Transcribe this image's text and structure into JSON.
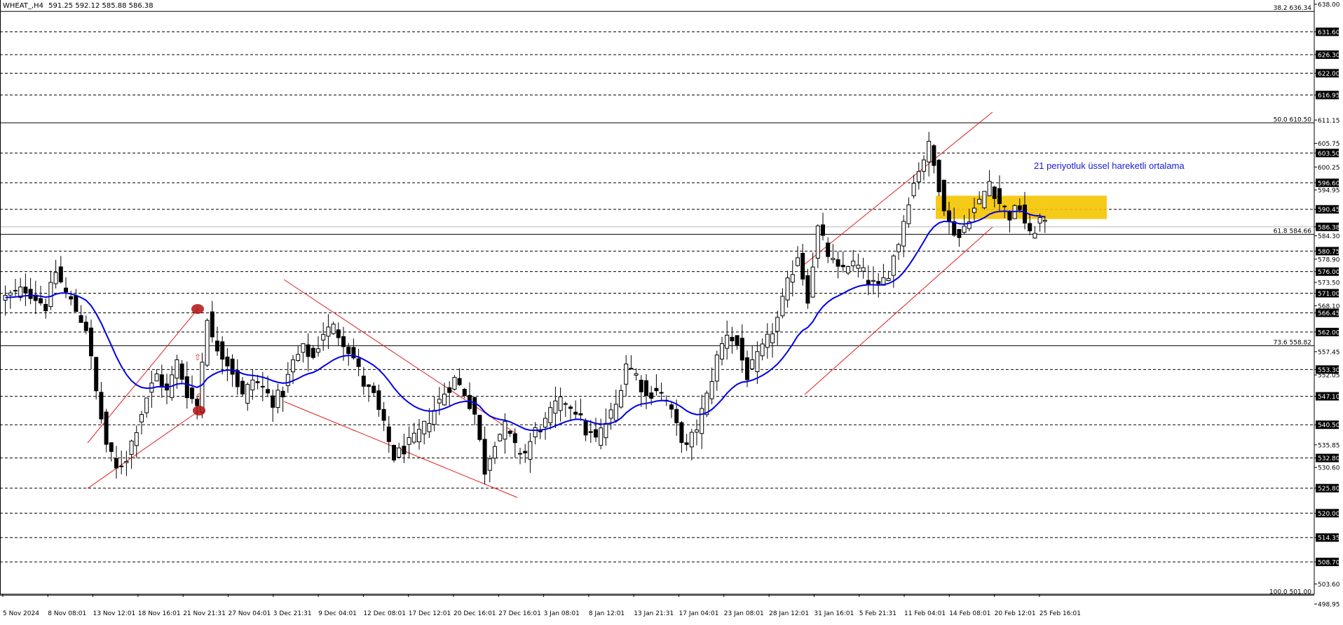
{
  "header": {
    "symbol": "WHEAT_,H4",
    "ohlc": "591.25 592.12 585.88 586.38"
  },
  "annotation": {
    "text": "21 periyotluk üssel hareketli ortalama"
  },
  "colors": {
    "background": "#ffffff",
    "candle": "#000000",
    "ema": "#0000e6",
    "channel": "#e02020",
    "zone": "#f5c400",
    "grid": "#000000",
    "marker": "#b01010",
    "arrow": "#e02020"
  },
  "chart_data": {
    "type": "candlestick",
    "ylim": [
      498.95,
      638.0
    ],
    "grid": true,
    "price_axis_labels": [
      "638.00",
      "631.60",
      "626.30",
      "622.00",
      "616.95",
      "611.15",
      "605.75",
      "603.50",
      "600.25",
      "596.60",
      "594.95",
      "590.45",
      "586.38",
      "584.30",
      "580.75",
      "578.90",
      "576.00",
      "573.50",
      "571.00",
      "568.10",
      "566.45",
      "562.00",
      "557.45",
      "553.30",
      "552.05",
      "547.10",
      "540.50",
      "535.85",
      "532.80",
      "530.60",
      "525.80",
      "520.00",
      "514.35",
      "508.70",
      "503.60",
      "498.95"
    ],
    "highlighted_levels": [
      631.6,
      626.3,
      622.0,
      616.95,
      603.5,
      596.6,
      590.45,
      586.38,
      580.75,
      576.0,
      571.0,
      566.45,
      562.0,
      553.3,
      547.1,
      540.5,
      532.8,
      525.8,
      520.0,
      514.35,
      508.7
    ],
    "dashed_levels": [
      631.6,
      626.3,
      622.0,
      616.95,
      603.5,
      596.6,
      590.45,
      580.75,
      576.0,
      571.0,
      566.45,
      562.0,
      553.3,
      547.1,
      540.5,
      532.8,
      525.8,
      520.0,
      514.35,
      508.7
    ],
    "current_price": 586.38,
    "fibonacci": [
      {
        "label": "38.2 636.34",
        "price": 636.34
      },
      {
        "label": "50.0 610.50",
        "price": 610.5
      },
      {
        "label": "61.8 584.66",
        "price": 584.66
      },
      {
        "label": "73.6 558.82",
        "price": 558.82
      },
      {
        "label": "100.0 501.00",
        "price": 501.0
      }
    ],
    "time_labels": [
      "5 Nov 2024",
      "8 Nov 08:01",
      "13 Nov 12:01",
      "18 Nov 16:01",
      "21 Nov 21:31",
      "27 Nov 04:01",
      "3 Dec 21:31",
      "9 Dec 04:01",
      "12 Dec 08:01",
      "17 Dec 12:01",
      "20 Dec 16:01",
      "27 Dec 16:01",
      "3 Jan 08:01",
      "8 Jan 12:01",
      "13 Jan 21:31",
      "17 Jan 04:01",
      "23 Jan 08:01",
      "28 Jan 12:01",
      "31 Jan 16:01",
      "5 Feb 21:31",
      "11 Feb 04:01",
      "14 Feb 08:01",
      "20 Feb 12:01",
      "25 Feb 16:01"
    ],
    "close_path": [
      [
        0,
        570
      ],
      [
        4,
        572
      ],
      [
        8,
        568
      ],
      [
        10,
        576
      ],
      [
        12,
        571
      ],
      [
        16,
        563
      ],
      [
        18,
        548
      ],
      [
        20,
        536
      ],
      [
        22,
        530
      ],
      [
        24,
        533
      ],
      [
        26,
        540
      ],
      [
        28,
        547
      ],
      [
        30,
        552
      ],
      [
        32,
        548
      ],
      [
        34,
        555
      ],
      [
        36,
        548
      ],
      [
        38,
        545
      ],
      [
        40,
        566
      ],
      [
        41,
        560
      ],
      [
        43,
        557
      ],
      [
        45,
        553
      ],
      [
        47,
        547
      ],
      [
        49,
        551
      ],
      [
        51,
        549
      ],
      [
        53,
        546
      ],
      [
        55,
        548
      ],
      [
        57,
        555
      ],
      [
        59,
        558
      ],
      [
        61,
        556
      ],
      [
        63,
        562
      ],
      [
        65,
        563
      ],
      [
        67,
        560
      ],
      [
        69,
        556
      ],
      [
        71,
        550
      ],
      [
        73,
        547
      ],
      [
        75,
        540
      ],
      [
        77,
        533
      ],
      [
        79,
        535
      ],
      [
        81,
        537
      ],
      [
        83,
        540
      ],
      [
        85,
        544
      ],
      [
        87,
        548
      ],
      [
        89,
        551
      ],
      [
        91,
        548
      ],
      [
        93,
        543
      ],
      [
        95,
        530
      ],
      [
        97,
        537
      ],
      [
        99,
        540
      ],
      [
        101,
        535
      ],
      [
        103,
        534
      ],
      [
        105,
        539
      ],
      [
        107,
        541
      ],
      [
        109,
        545
      ],
      [
        111,
        546
      ],
      [
        113,
        544
      ],
      [
        115,
        539
      ],
      [
        117,
        537
      ],
      [
        119,
        541
      ],
      [
        121,
        545
      ],
      [
        123,
        555
      ],
      [
        125,
        552
      ],
      [
        127,
        547
      ],
      [
        129,
        549
      ],
      [
        131,
        546
      ],
      [
        133,
        540
      ],
      [
        135,
        535
      ],
      [
        137,
        540
      ],
      [
        139,
        547
      ],
      [
        141,
        556
      ],
      [
        143,
        562
      ],
      [
        145,
        559
      ],
      [
        147,
        552
      ],
      [
        149,
        556
      ],
      [
        151,
        560
      ],
      [
        153,
        565
      ],
      [
        155,
        573
      ],
      [
        157,
        580
      ],
      [
        159,
        570
      ],
      [
        161,
        586
      ],
      [
        163,
        580
      ],
      [
        165,
        576
      ],
      [
        167,
        578
      ],
      [
        169,
        577
      ],
      [
        171,
        574
      ],
      [
        173,
        572
      ],
      [
        175,
        576
      ],
      [
        177,
        583
      ],
      [
        179,
        593
      ],
      [
        181,
        600
      ],
      [
        183,
        605
      ],
      [
        185,
        596
      ],
      [
        187,
        587
      ],
      [
        189,
        584
      ],
      [
        191,
        589
      ],
      [
        193,
        592
      ],
      [
        195,
        597
      ],
      [
        197,
        592
      ],
      [
        199,
        589
      ],
      [
        201,
        591
      ],
      [
        203,
        584
      ],
      [
        205,
        588
      ],
      [
        206,
        586.38
      ]
    ]
  }
}
